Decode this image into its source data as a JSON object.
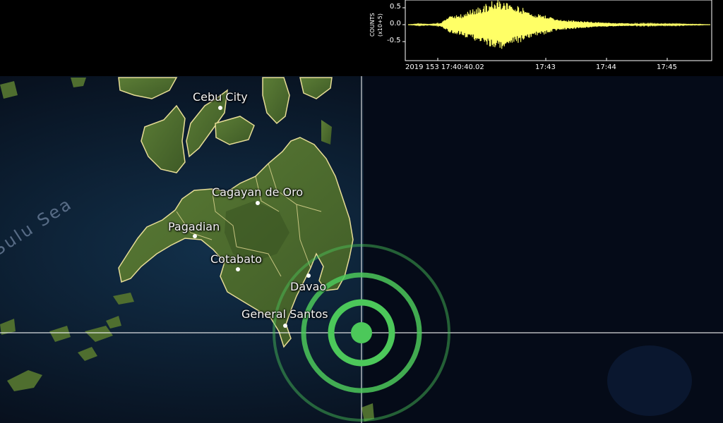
{
  "map": {
    "sea_label": "Sulu Sea",
    "cities": [
      {
        "name": "Cebu City"
      },
      {
        "name": "Cagayan de Oro"
      },
      {
        "name": "Pagadian"
      },
      {
        "name": "Cotabato"
      },
      {
        "name": "Davao"
      },
      {
        "name": "General Santos"
      }
    ],
    "colors": {
      "land": "#4a6a2c",
      "ocean": "#0a1a2e",
      "border": "#e6dc96",
      "epicenter": "#4cc85a",
      "crosshair": "#ffffff"
    },
    "epicenter_marker_icon": "concentric-rings-icon"
  },
  "seismogram": {
    "y_axis_title_line1": "COUNTS",
    "y_axis_title_line2": "(x10+5)",
    "y_ticks": [
      "0.5",
      "0.0",
      "-0.5"
    ],
    "x_ticks": [
      "2019 153 17:40:40.02",
      "17:43",
      "17:44",
      "17:45"
    ],
    "trace_color": "#ffff66"
  },
  "chart_data": {
    "type": "line",
    "title": "",
    "xlabel": "",
    "ylabel": "COUNTS (x10+5)",
    "ylim": [
      -0.8,
      0.8
    ],
    "x_ticks": [
      "2019 153 17:40:40.02",
      "17:43",
      "17:44",
      "17:45"
    ],
    "series": [
      {
        "values": [
          0.0,
          0.02,
          -0.01,
          0.03,
          0.25,
          -0.3,
          0.45,
          -0.55,
          0.7,
          -0.75,
          0.6,
          -0.5,
          0.35,
          -0.3,
          0.2,
          -0.15,
          0.12,
          -0.1,
          0.08,
          -0.06,
          0.05,
          -0.04,
          0.03,
          -0.03,
          0.02,
          -0.02,
          0.02,
          -0.01,
          0.01,
          0.0
        ]
      }
    ]
  }
}
